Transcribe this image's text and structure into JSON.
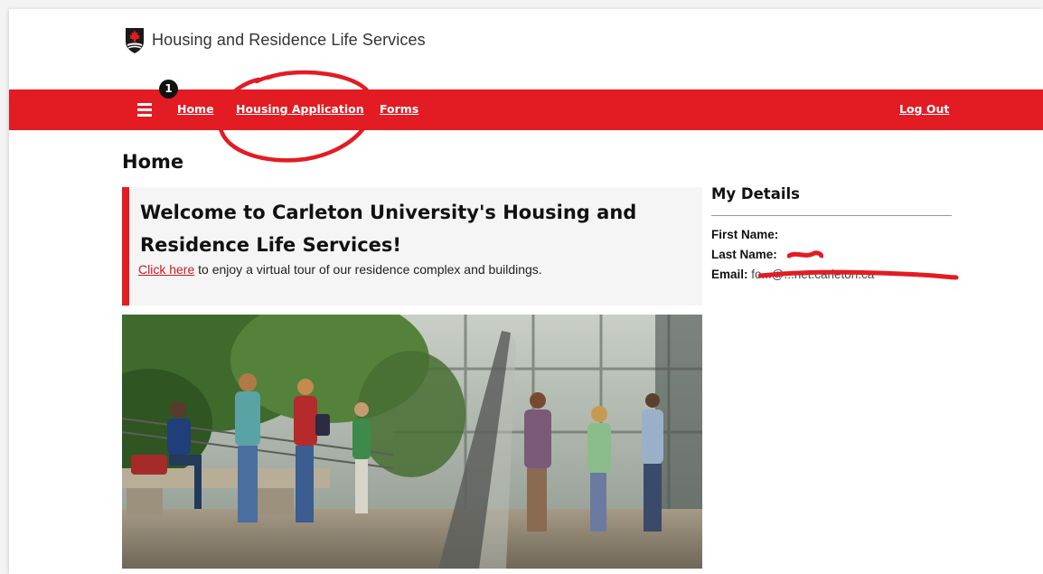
{
  "header": {
    "brand_text": "Housing and Residence Life Services"
  },
  "nav": {
    "badge_count": "1",
    "home_label": "Home",
    "housing_application_label": "Housing Application",
    "forms_label": "Forms",
    "logout_label": "Log Out",
    "bar_color": "#e31b23"
  },
  "main": {
    "page_title": "Home",
    "welcome_heading": "Welcome to Carleton University's Housing and Residence Life Services!",
    "tour_link_label": "Click here",
    "tour_text": " to enjoy a virtual tour of our residence complex and buildings."
  },
  "details": {
    "title": "My Details",
    "first_name_label": "First Name:",
    "last_name_label": "Last Name:",
    "email_label": "Email:",
    "email_visible_value": "fo...@...net.carleton.ca"
  },
  "icons": {
    "logo": "shield-maple-leaf-icon",
    "menu": "hamburger-menu-icon"
  }
}
